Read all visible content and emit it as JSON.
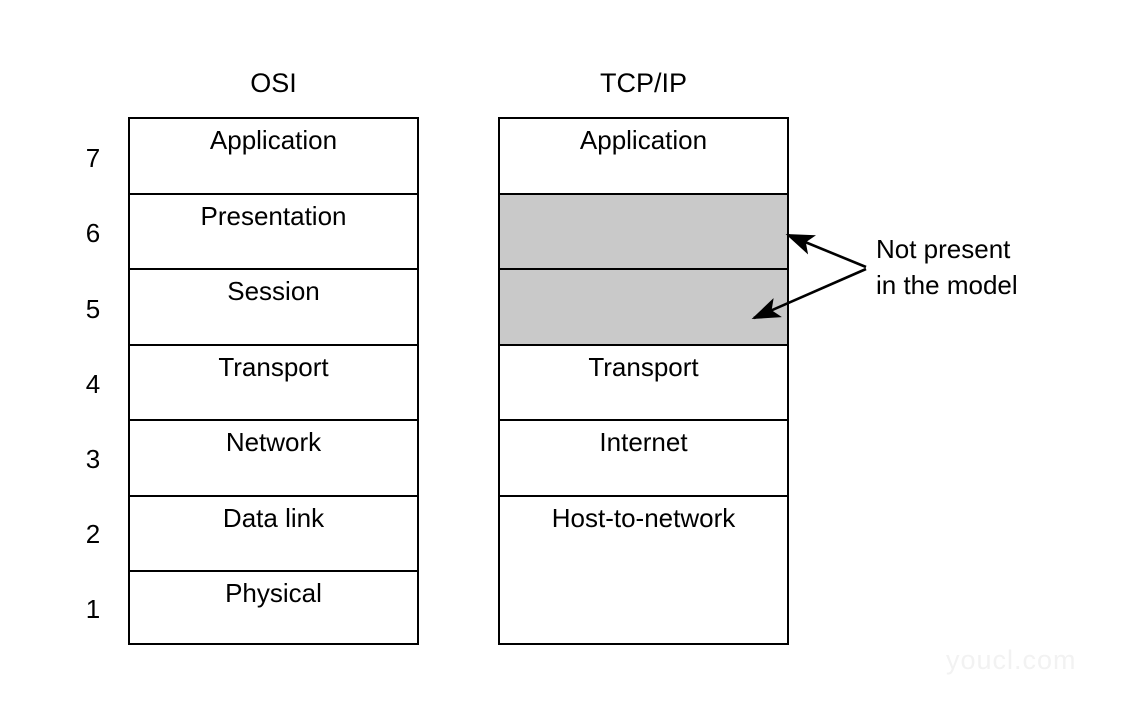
{
  "diagram": {
    "watermark": "youcl.com",
    "columns": {
      "osi": {
        "title": "OSI"
      },
      "tcpip": {
        "title": "TCP/IP"
      }
    },
    "layer_numbers": [
      "7",
      "6",
      "5",
      "4",
      "3",
      "2",
      "1"
    ],
    "osi_layers": [
      {
        "number": "7",
        "label": "Application"
      },
      {
        "number": "6",
        "label": "Presentation"
      },
      {
        "number": "5",
        "label": "Session"
      },
      {
        "number": "4",
        "label": "Transport"
      },
      {
        "number": "3",
        "label": "Network"
      },
      {
        "number": "2",
        "label": "Data link"
      },
      {
        "number": "1",
        "label": "Physical"
      }
    ],
    "tcpip_layers": [
      {
        "label": "Application",
        "shaded": false,
        "spans": 1
      },
      {
        "label": "",
        "shaded": true,
        "spans": 1
      },
      {
        "label": "",
        "shaded": true,
        "spans": 1
      },
      {
        "label": "Transport",
        "shaded": false,
        "spans": 1
      },
      {
        "label": "Internet",
        "shaded": false,
        "spans": 1
      },
      {
        "label": "Host-to-network",
        "shaded": false,
        "spans": 2
      }
    ],
    "annotation": {
      "line1": "Not present",
      "line2": "in the model"
    },
    "colors": {
      "shade": "#c9c9c9",
      "stroke": "#000000",
      "background": "#ffffff",
      "watermark": "#f2f2f2"
    }
  }
}
